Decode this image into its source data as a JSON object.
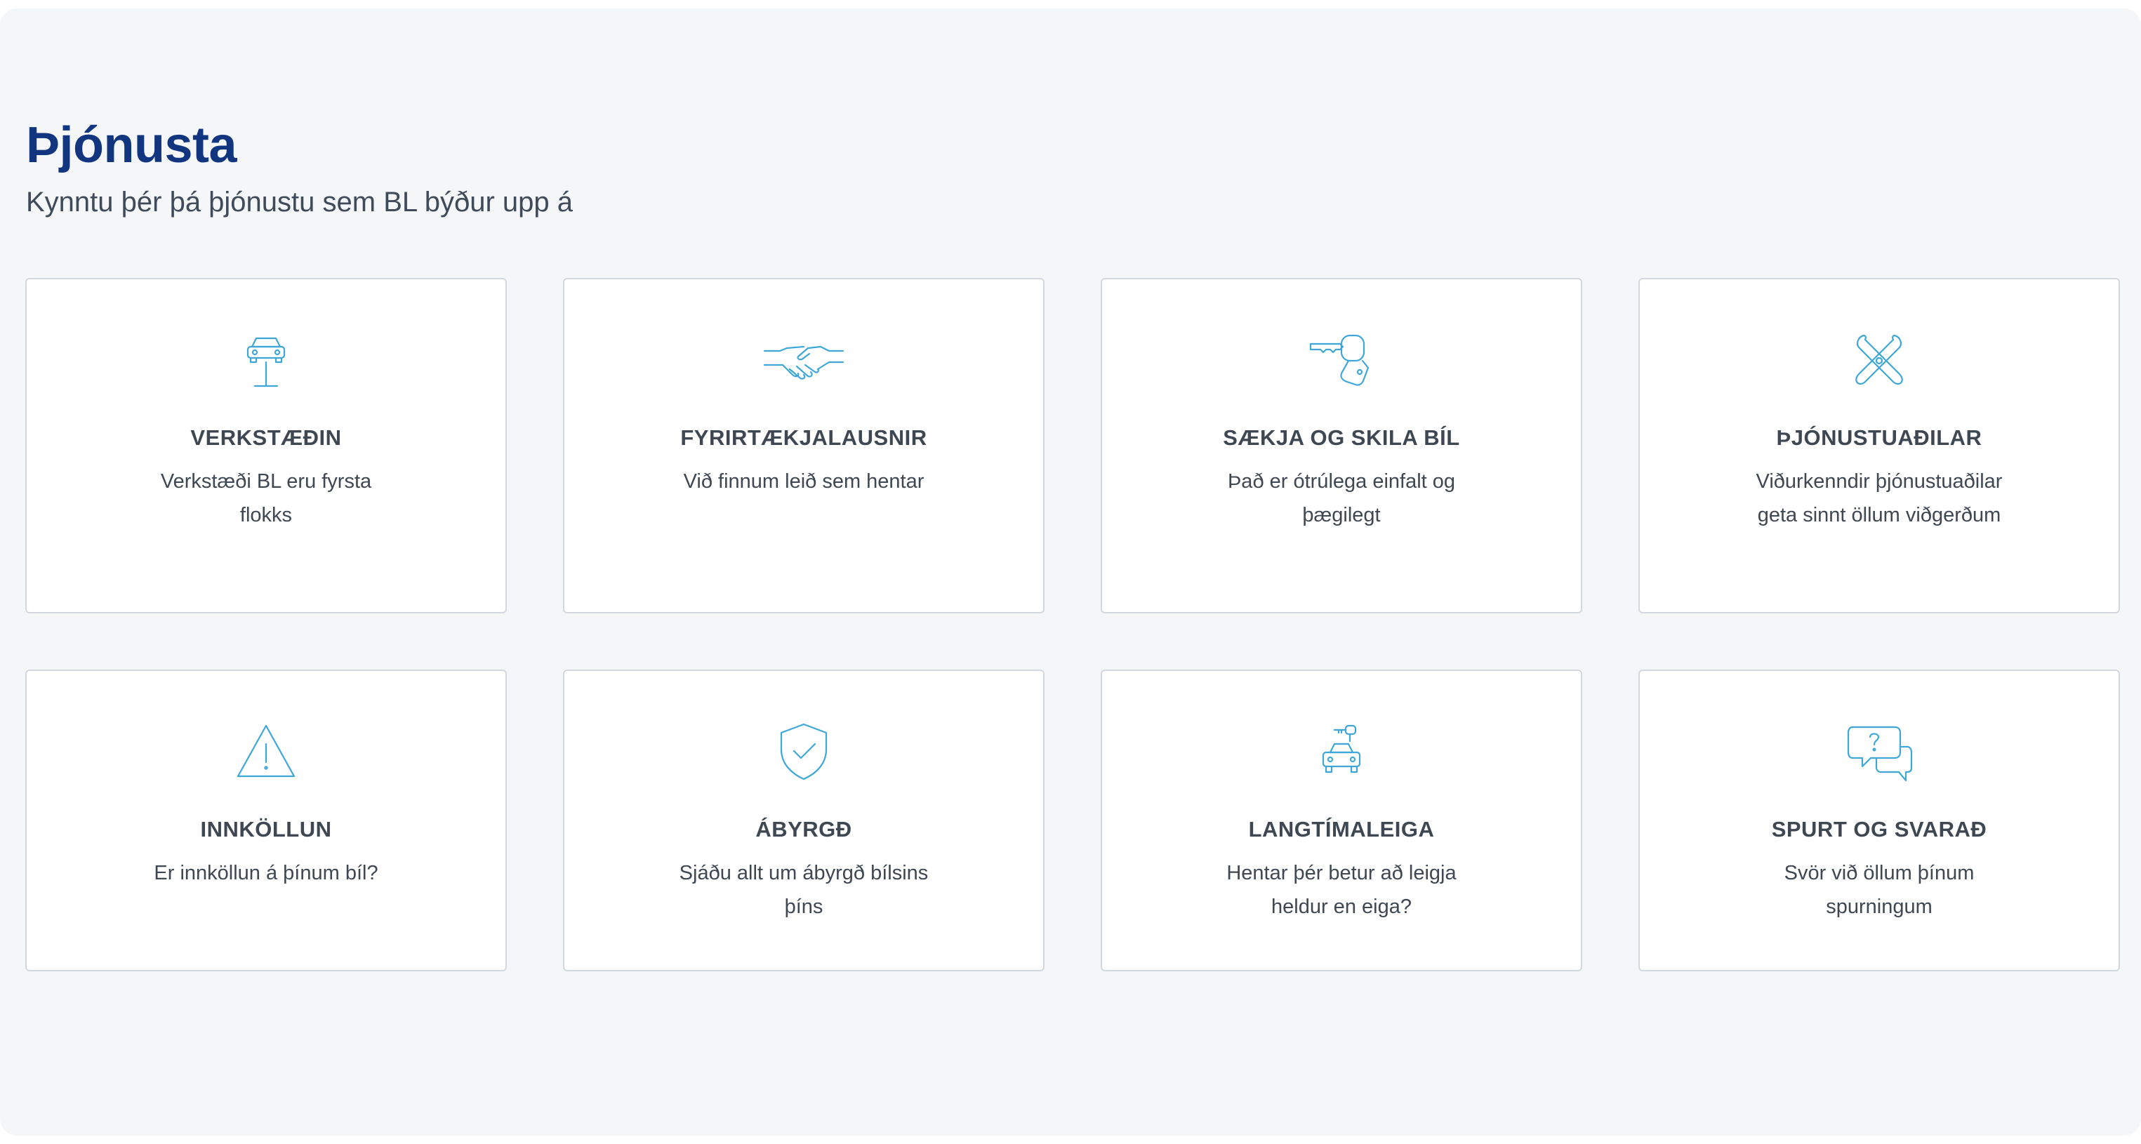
{
  "header": {
    "title": "Þjónusta",
    "subtitle": "Kynntu þér þá þjónustu sem BL býður upp á"
  },
  "accent_color": "#3ea7d8",
  "title_color": "#12357f",
  "cards": [
    {
      "icon": "car-lift-icon",
      "title": "VERKSTÆÐIN",
      "description": "Verkstæði BL eru fyrsta flokks"
    },
    {
      "icon": "handshake-icon",
      "title": "FYRIRTÆKJALAUSNIR",
      "description": "Við finnum leið sem hentar"
    },
    {
      "icon": "car-key-icon",
      "title": "SÆKJA OG SKILA BÍL",
      "description": "Það er ótrúlega einfalt og þægilegt"
    },
    {
      "icon": "wrench-tools-icon",
      "title": "ÞJÓNUSTUAÐILAR",
      "description": "Viðurkenndir þjónustuaðilar geta sinnt öllum viðgerðum"
    },
    {
      "icon": "warning-icon",
      "title": "INNKÖLLUN",
      "description": "Er innköllun á þínum bíl?"
    },
    {
      "icon": "shield-check-icon",
      "title": "ÁBYRGÐ",
      "description": "Sjáðu allt um ábyrgð bílsins þíns"
    },
    {
      "icon": "car-with-key-icon",
      "title": "LANGTÍMALEIGA",
      "description": "Hentar þér betur að leigja heldur en eiga?"
    },
    {
      "icon": "question-chat-icon",
      "title": "SPURT OG SVARAÐ",
      "description": "Svör við öllum þínum spurningum"
    }
  ]
}
